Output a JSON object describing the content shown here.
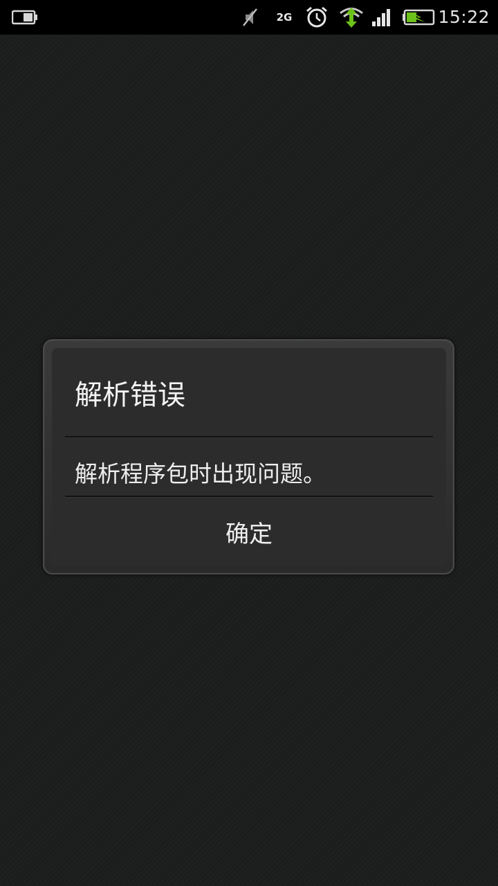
{
  "status_bar": {
    "clock": "15:22",
    "network_type": "2G",
    "icons": [
      "battery-small-icon",
      "mute-icon",
      "alarm-icon",
      "data-transfer-icon",
      "signal-icon",
      "battery-charging-icon"
    ],
    "accent_color": "#6cc21a"
  },
  "dialog": {
    "title": "解析错误",
    "message": "解析程序包时出现问题。",
    "ok_label": "确定"
  }
}
